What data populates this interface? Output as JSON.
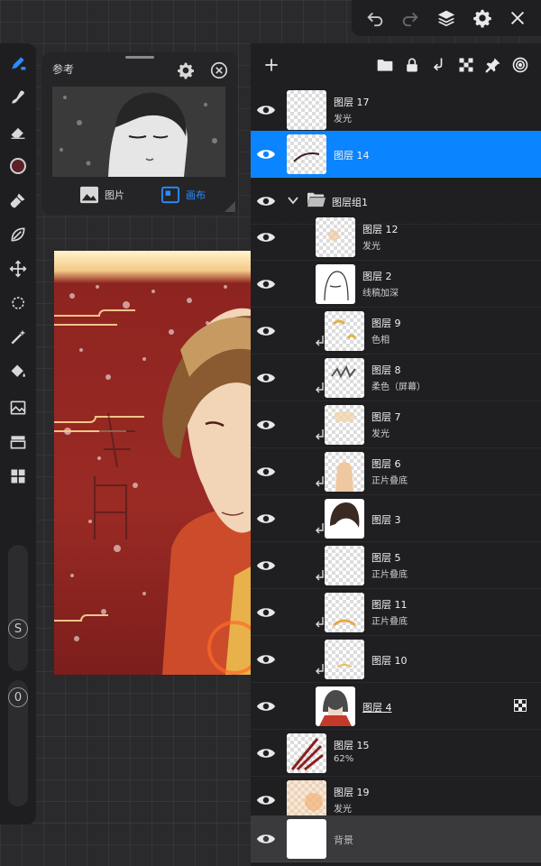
{
  "topbar": {
    "icons": [
      "undo-icon",
      "redo-icon",
      "layers-icon",
      "settings-icon",
      "close-icon"
    ]
  },
  "toolrail": {
    "icons": [
      "brush-icon",
      "smudge-icon",
      "eraser-icon",
      "color-icon",
      "paint-brush-icon",
      "lasso-icon",
      "transform-icon",
      "selection-icon",
      "magic-wand-icon",
      "fill-icon",
      "image-adjust-icon",
      "canvas-icon",
      "layout-icon"
    ],
    "size_label": "S",
    "opacity_label": "0"
  },
  "reference": {
    "title": "参考",
    "tabs": {
      "image": "图片",
      "canvas": "画布"
    },
    "active_tab": "canvas"
  },
  "layers_toolbar": {
    "icons": [
      "add-layer-icon",
      "folder-icon",
      "lock-icon",
      "merge-down-icon",
      "transparent-icon",
      "pin-icon",
      "spiral-icon"
    ]
  },
  "layers": [
    {
      "name": "图层 17",
      "sub": "发光",
      "selected": false
    },
    {
      "name": "图层 14",
      "sub": "",
      "selected": true
    },
    {
      "name": "图层组1",
      "group": true
    },
    {
      "name": "图层 12",
      "sub": "发光"
    },
    {
      "name": "图层 2",
      "sub": "线稿加深"
    },
    {
      "name": "图层 9",
      "sub": "色相",
      "clip": true
    },
    {
      "name": "图层 8",
      "sub": "柔色（屏幕）",
      "clip": true
    },
    {
      "name": "图层 7",
      "sub": "发光",
      "clip": true
    },
    {
      "name": "图层 6",
      "sub": "正片叠底",
      "clip": true
    },
    {
      "name": "图层 3",
      "sub": "",
      "clip": true
    },
    {
      "name": "图层 5",
      "sub": "正片叠底",
      "clip": true
    },
    {
      "name": "图层 11",
      "sub": "正片叠底",
      "clip": true
    },
    {
      "name": "图层 10",
      "sub": "",
      "clip": true
    },
    {
      "name": "图层 4",
      "sub": "",
      "underlined": true,
      "mask": true
    },
    {
      "name": "图层 15",
      "sub": "62%"
    },
    {
      "name": "图层 19",
      "sub": "发光"
    },
    {
      "name": "背景",
      "sub": "",
      "background": true
    }
  ],
  "colors": {
    "accent": "#0a84ff",
    "panel": "#1e1e20",
    "canvas_red": "#9a2a24"
  }
}
